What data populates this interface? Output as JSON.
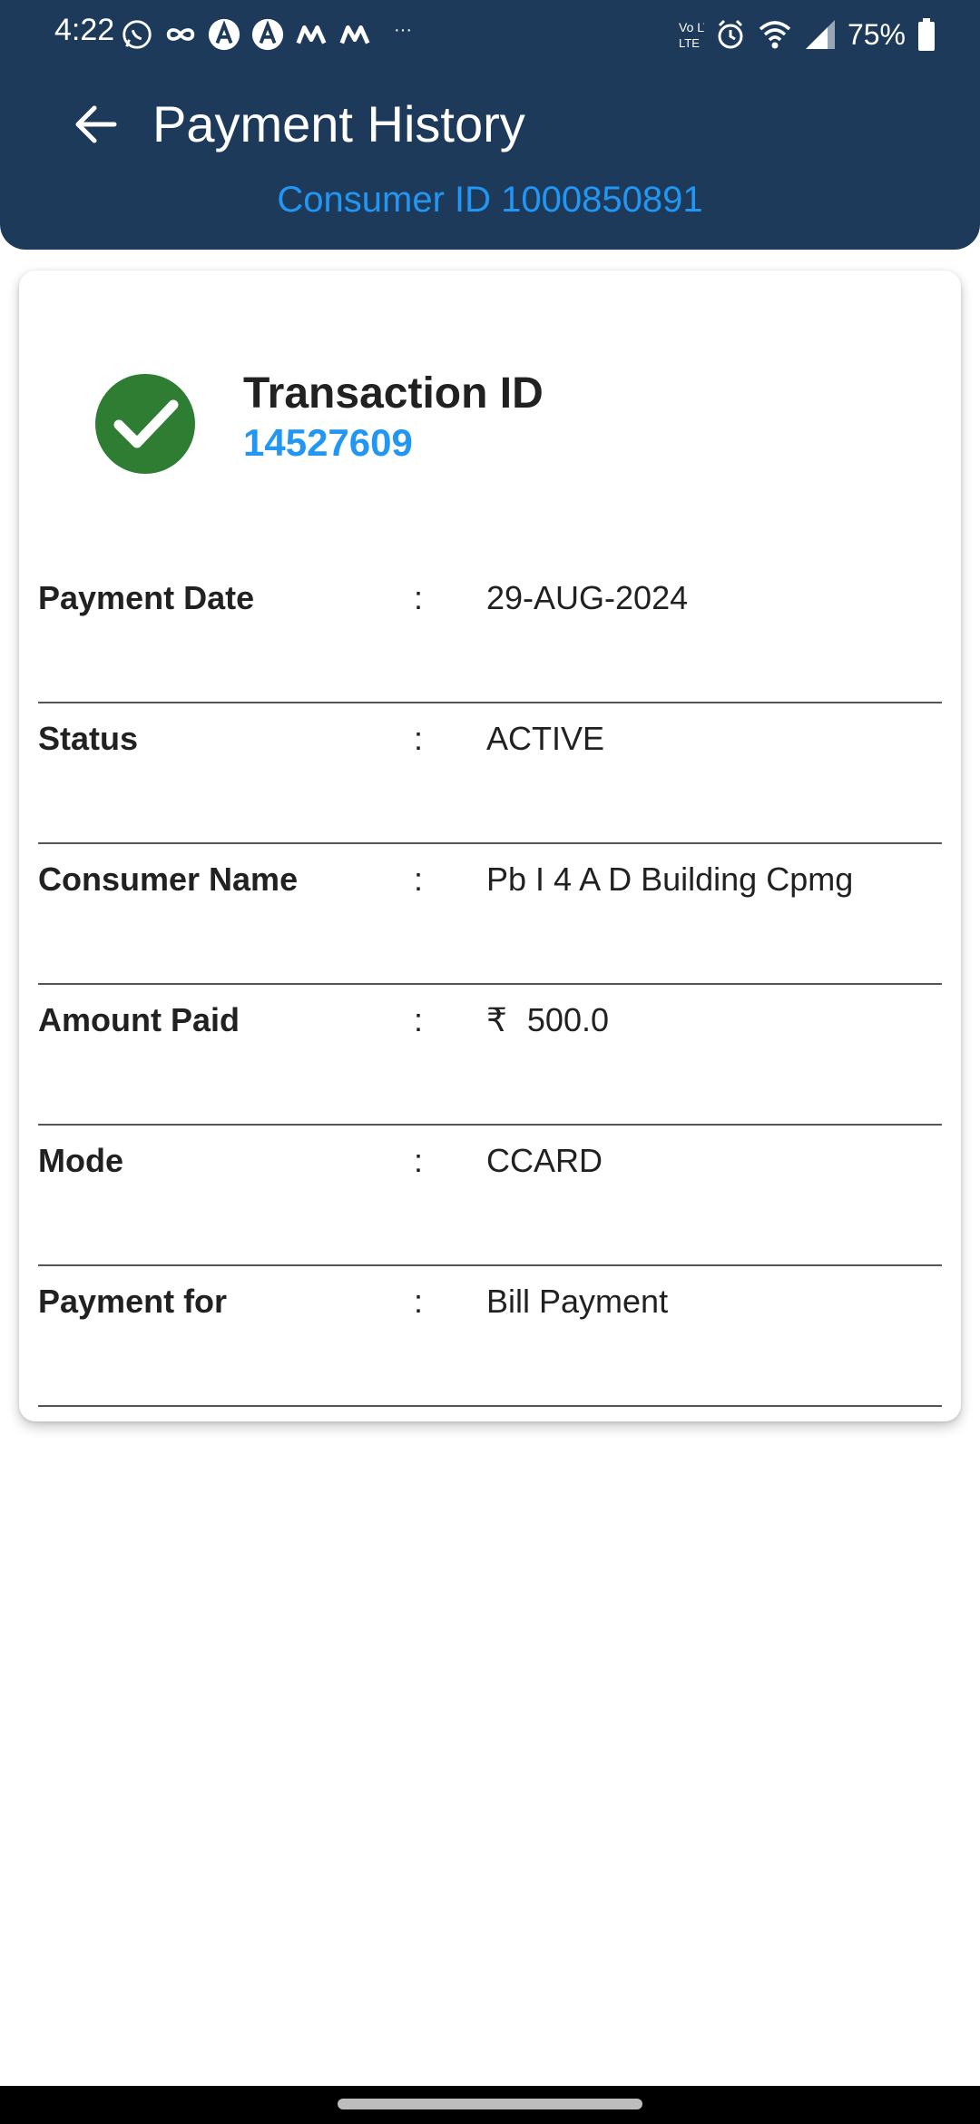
{
  "status_bar": {
    "time": "4:22",
    "left_icons": [
      "whatsapp-icon",
      "infinity-icon",
      "a-logo-icon",
      "a-logo-icon",
      "m-logo-icon",
      "m-logo-icon"
    ],
    "more_dots": "···",
    "network_label": "Vo LTE",
    "battery_percent": "75%"
  },
  "header": {
    "title": "Payment History",
    "consumer_id": "Consumer ID 1000850891"
  },
  "transaction": {
    "label": "Transaction ID",
    "id": "14527609",
    "status_icon": "check-circle-icon"
  },
  "details": [
    {
      "label": "Payment Date",
      "colon": ":",
      "value": "29-AUG-2024"
    },
    {
      "label": "Status",
      "colon": ":",
      "value": "ACTIVE"
    },
    {
      "label": "Consumer Name",
      "colon": ":",
      "value": "Pb I 4 A D Building Cpmg"
    },
    {
      "label": "Amount Paid",
      "colon": ":",
      "currency": "₹",
      "value": "500.0"
    },
    {
      "label": "Mode",
      "colon": ":",
      "value": "CCARD"
    },
    {
      "label": "Payment for",
      "colon": ":",
      "value": "Bill Payment"
    }
  ],
  "colors": {
    "header_bg": "#1e3a5b",
    "accent_blue": "#2196f3",
    "success_green": "#2e7d32"
  }
}
